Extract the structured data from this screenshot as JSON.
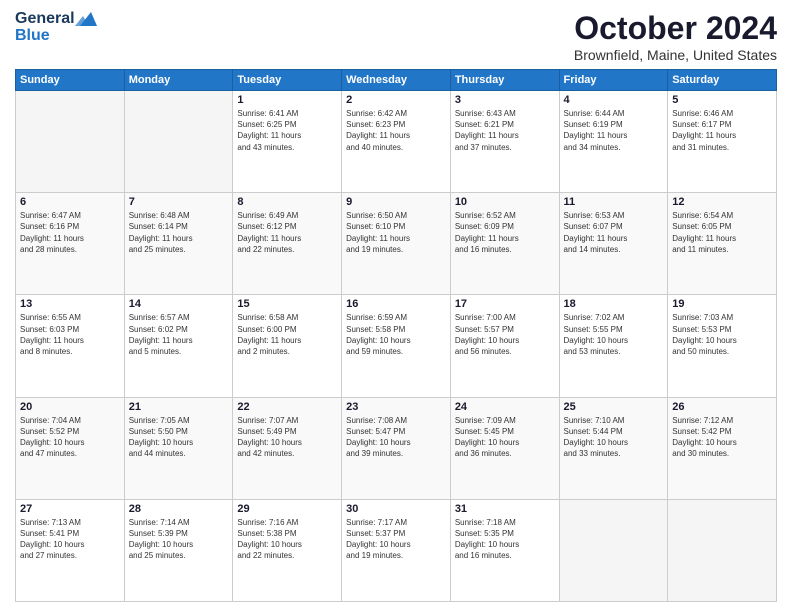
{
  "header": {
    "logo_top": "General",
    "logo_bottom": "Blue",
    "title": "October 2024",
    "subtitle": "Brownfield, Maine, United States"
  },
  "days_of_week": [
    "Sunday",
    "Monday",
    "Tuesday",
    "Wednesday",
    "Thursday",
    "Friday",
    "Saturday"
  ],
  "weeks": [
    [
      {
        "day": "",
        "info": ""
      },
      {
        "day": "",
        "info": ""
      },
      {
        "day": "1",
        "info": "Sunrise: 6:41 AM\nSunset: 6:25 PM\nDaylight: 11 hours\nand 43 minutes."
      },
      {
        "day": "2",
        "info": "Sunrise: 6:42 AM\nSunset: 6:23 PM\nDaylight: 11 hours\nand 40 minutes."
      },
      {
        "day": "3",
        "info": "Sunrise: 6:43 AM\nSunset: 6:21 PM\nDaylight: 11 hours\nand 37 minutes."
      },
      {
        "day": "4",
        "info": "Sunrise: 6:44 AM\nSunset: 6:19 PM\nDaylight: 11 hours\nand 34 minutes."
      },
      {
        "day": "5",
        "info": "Sunrise: 6:46 AM\nSunset: 6:17 PM\nDaylight: 11 hours\nand 31 minutes."
      }
    ],
    [
      {
        "day": "6",
        "info": "Sunrise: 6:47 AM\nSunset: 6:16 PM\nDaylight: 11 hours\nand 28 minutes."
      },
      {
        "day": "7",
        "info": "Sunrise: 6:48 AM\nSunset: 6:14 PM\nDaylight: 11 hours\nand 25 minutes."
      },
      {
        "day": "8",
        "info": "Sunrise: 6:49 AM\nSunset: 6:12 PM\nDaylight: 11 hours\nand 22 minutes."
      },
      {
        "day": "9",
        "info": "Sunrise: 6:50 AM\nSunset: 6:10 PM\nDaylight: 11 hours\nand 19 minutes."
      },
      {
        "day": "10",
        "info": "Sunrise: 6:52 AM\nSunset: 6:09 PM\nDaylight: 11 hours\nand 16 minutes."
      },
      {
        "day": "11",
        "info": "Sunrise: 6:53 AM\nSunset: 6:07 PM\nDaylight: 11 hours\nand 14 minutes."
      },
      {
        "day": "12",
        "info": "Sunrise: 6:54 AM\nSunset: 6:05 PM\nDaylight: 11 hours\nand 11 minutes."
      }
    ],
    [
      {
        "day": "13",
        "info": "Sunrise: 6:55 AM\nSunset: 6:03 PM\nDaylight: 11 hours\nand 8 minutes."
      },
      {
        "day": "14",
        "info": "Sunrise: 6:57 AM\nSunset: 6:02 PM\nDaylight: 11 hours\nand 5 minutes."
      },
      {
        "day": "15",
        "info": "Sunrise: 6:58 AM\nSunset: 6:00 PM\nDaylight: 11 hours\nand 2 minutes."
      },
      {
        "day": "16",
        "info": "Sunrise: 6:59 AM\nSunset: 5:58 PM\nDaylight: 10 hours\nand 59 minutes."
      },
      {
        "day": "17",
        "info": "Sunrise: 7:00 AM\nSunset: 5:57 PM\nDaylight: 10 hours\nand 56 minutes."
      },
      {
        "day": "18",
        "info": "Sunrise: 7:02 AM\nSunset: 5:55 PM\nDaylight: 10 hours\nand 53 minutes."
      },
      {
        "day": "19",
        "info": "Sunrise: 7:03 AM\nSunset: 5:53 PM\nDaylight: 10 hours\nand 50 minutes."
      }
    ],
    [
      {
        "day": "20",
        "info": "Sunrise: 7:04 AM\nSunset: 5:52 PM\nDaylight: 10 hours\nand 47 minutes."
      },
      {
        "day": "21",
        "info": "Sunrise: 7:05 AM\nSunset: 5:50 PM\nDaylight: 10 hours\nand 44 minutes."
      },
      {
        "day": "22",
        "info": "Sunrise: 7:07 AM\nSunset: 5:49 PM\nDaylight: 10 hours\nand 42 minutes."
      },
      {
        "day": "23",
        "info": "Sunrise: 7:08 AM\nSunset: 5:47 PM\nDaylight: 10 hours\nand 39 minutes."
      },
      {
        "day": "24",
        "info": "Sunrise: 7:09 AM\nSunset: 5:45 PM\nDaylight: 10 hours\nand 36 minutes."
      },
      {
        "day": "25",
        "info": "Sunrise: 7:10 AM\nSunset: 5:44 PM\nDaylight: 10 hours\nand 33 minutes."
      },
      {
        "day": "26",
        "info": "Sunrise: 7:12 AM\nSunset: 5:42 PM\nDaylight: 10 hours\nand 30 minutes."
      }
    ],
    [
      {
        "day": "27",
        "info": "Sunrise: 7:13 AM\nSunset: 5:41 PM\nDaylight: 10 hours\nand 27 minutes."
      },
      {
        "day": "28",
        "info": "Sunrise: 7:14 AM\nSunset: 5:39 PM\nDaylight: 10 hours\nand 25 minutes."
      },
      {
        "day": "29",
        "info": "Sunrise: 7:16 AM\nSunset: 5:38 PM\nDaylight: 10 hours\nand 22 minutes."
      },
      {
        "day": "30",
        "info": "Sunrise: 7:17 AM\nSunset: 5:37 PM\nDaylight: 10 hours\nand 19 minutes."
      },
      {
        "day": "31",
        "info": "Sunrise: 7:18 AM\nSunset: 5:35 PM\nDaylight: 10 hours\nand 16 minutes."
      },
      {
        "day": "",
        "info": ""
      },
      {
        "day": "",
        "info": ""
      }
    ]
  ]
}
